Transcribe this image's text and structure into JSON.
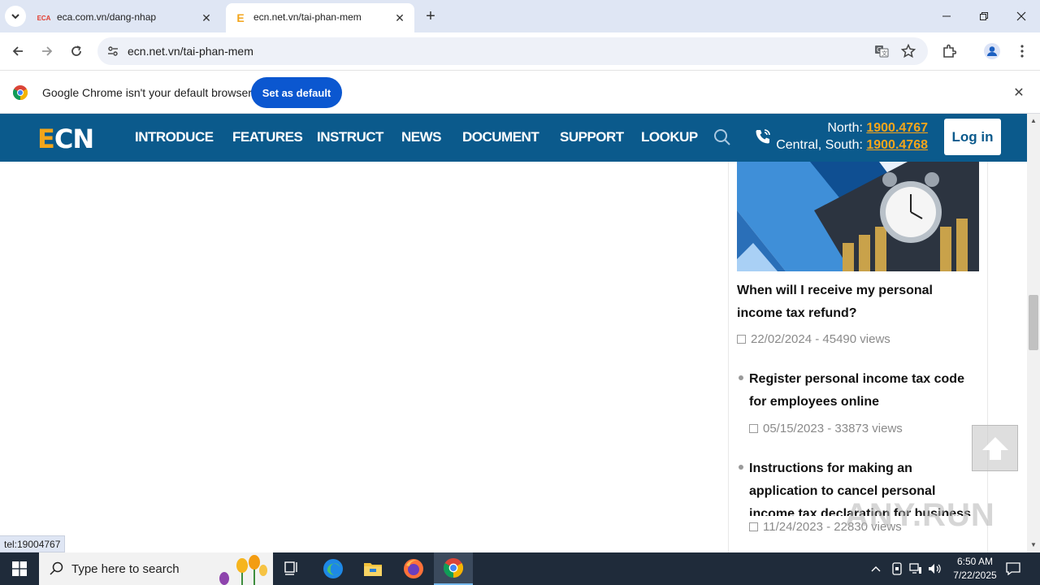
{
  "browser": {
    "tabs": [
      {
        "title": "eca.com.vn/dang-nhap",
        "favicon_text": "ECA",
        "active": false
      },
      {
        "title": "ecn.net.vn/tai-phan-mem",
        "favicon_text": "E",
        "active": true
      }
    ],
    "url": "ecn.net.vn/tai-phan-mem",
    "infobar": {
      "message": "Google Chrome isn't your default browser",
      "button": "Set as default"
    },
    "status_url": "tel:19004767"
  },
  "site": {
    "logo": {
      "e": "E",
      "rest": "CN"
    },
    "menu": [
      "INTRODUCE",
      "FEATURES",
      "INSTRUCT",
      "NEWS",
      "DOCUMENT",
      "SUPPORT",
      "LOOKUP"
    ],
    "hotline": {
      "north_label": "North: ",
      "north_number": "1900.4767",
      "south_label": "Central, South: ",
      "south_number": "1900.4768"
    },
    "login": "Log in",
    "colors": {
      "header": "#0b5a8c",
      "accent": "#f3a51b"
    }
  },
  "sidebar": {
    "featured": {
      "title": "When will I receive my personal income tax refund?",
      "meta": "22/02/2024 - 45490 views"
    },
    "list": [
      {
        "title": "Register personal income tax code for employees online",
        "meta": "05/15/2023 - 33873 views"
      },
      {
        "title": "Instructions for making an application to cancel personal income tax declaration for business and",
        "meta": "11/24/2023 - 22830 views"
      }
    ]
  },
  "watermark": "ANY.RUN",
  "taskbar": {
    "search_placeholder": "Type here to search",
    "time": "6:50 AM",
    "date": "7/22/2025"
  }
}
